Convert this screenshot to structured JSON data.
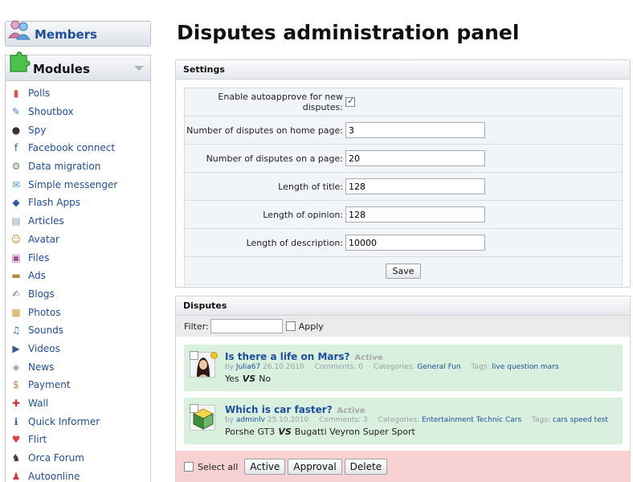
{
  "sidebar": {
    "members_label": "Members",
    "modules_label": "Modules",
    "modules": [
      {
        "label": "Polls",
        "icon": "polls-icon"
      },
      {
        "label": "Shoutbox",
        "icon": "shoutbox-icon"
      },
      {
        "label": "Spy",
        "icon": "spy-icon"
      },
      {
        "label": "Facebook connect",
        "icon": "facebook-icon"
      },
      {
        "label": "Data migration",
        "icon": "data-migration-icon"
      },
      {
        "label": "Simple messenger",
        "icon": "messenger-icon"
      },
      {
        "label": "Flash Apps",
        "icon": "flash-icon"
      },
      {
        "label": "Articles",
        "icon": "articles-icon"
      },
      {
        "label": "Avatar",
        "icon": "avatar-icon"
      },
      {
        "label": "Files",
        "icon": "files-icon"
      },
      {
        "label": "Ads",
        "icon": "ads-icon"
      },
      {
        "label": "Blogs",
        "icon": "blogs-icon"
      },
      {
        "label": "Photos",
        "icon": "photos-icon"
      },
      {
        "label": "Sounds",
        "icon": "sounds-icon"
      },
      {
        "label": "Videos",
        "icon": "videos-icon"
      },
      {
        "label": "News",
        "icon": "news-icon"
      },
      {
        "label": "Payment",
        "icon": "payment-icon"
      },
      {
        "label": "Wall",
        "icon": "wall-icon"
      },
      {
        "label": "Quick Informer",
        "icon": "info-icon"
      },
      {
        "label": "Flirt",
        "icon": "heart-icon"
      },
      {
        "label": "Orca Forum",
        "icon": "forum-icon"
      },
      {
        "label": "Autoonline",
        "icon": "autoonline-icon"
      }
    ]
  },
  "page_title": "Disputes administration panel",
  "settings": {
    "header": "Settings",
    "autoapprove_label": "Enable autoapprove for new disputes:",
    "autoapprove_checked": true,
    "home_count_label": "Number of disputes on home page:",
    "home_count_value": "3",
    "page_count_label": "Number of disputes on a page:",
    "page_count_value": "20",
    "title_len_label": "Length of title:",
    "title_len_value": "128",
    "opinion_len_label": "Length of opinion:",
    "opinion_len_value": "128",
    "desc_len_label": "Length of description:",
    "desc_len_value": "10000",
    "save_label": "Save"
  },
  "disputes": {
    "header": "Disputes",
    "filter_label": "Filter:",
    "filter_value": "",
    "apply_label": "Apply",
    "items": [
      {
        "title": "Is there a life on Mars?",
        "status": "Active",
        "by": "by",
        "author": "Julia67",
        "date": "26.10.2010",
        "comments": "Comments: 0",
        "categories_label": "Categories:",
        "categories": [
          "General",
          "Fun"
        ],
        "tags_label": "Tags:",
        "tags": [
          "live",
          "question",
          "mars"
        ],
        "option_a": "Yes",
        "vs": "VS",
        "option_b": "No"
      },
      {
        "title": "Which is car faster?",
        "status": "Active",
        "by": "by",
        "author": "adminlv",
        "date": "25.10.2010",
        "comments": "Comments: 3",
        "categories_label": "Categories:",
        "categories": [
          "Entertainment",
          "Technic",
          "Cars"
        ],
        "tags_label": "Tags:",
        "tags": [
          "cars",
          "speed test"
        ],
        "option_a": "Porshe GT3",
        "vs": "VS",
        "option_b": "Bugatti Veyron Super Sport"
      }
    ],
    "select_all_label": "Select all",
    "active_button": "Active",
    "approval_button": "Approval",
    "delete_button": "Delete"
  },
  "colors": {
    "link": "#1e4e9c",
    "dispute_bg": "#d8f0dd",
    "bulk_bar_bg": "#f8d2d2",
    "status_dot": "#f1c232"
  }
}
